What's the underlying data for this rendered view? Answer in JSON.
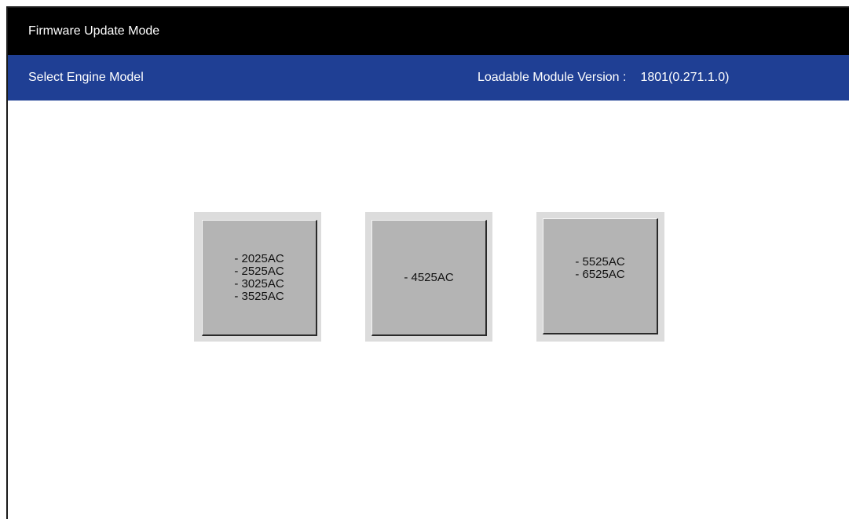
{
  "title_bar": {
    "title": "Firmware Update Mode"
  },
  "header": {
    "left_label": "Select Engine Model",
    "version_label": "Loadable Module Version :",
    "version_value": "1801(0.271.1.0)"
  },
  "models": [
    {
      "lines": [
        "- 2025AC",
        "- 2525AC",
        "- 3025AC",
        "- 3525AC"
      ]
    },
    {
      "lines": [
        "- 4525AC"
      ]
    },
    {
      "lines": [
        "- 5525AC",
        "- 6525AC"
      ]
    }
  ],
  "colors": {
    "title_bar_bg": "#000000",
    "header_bg": "#1f3f94",
    "button_face": "#b4b4b4",
    "button_frame": "#dcdcdc"
  }
}
